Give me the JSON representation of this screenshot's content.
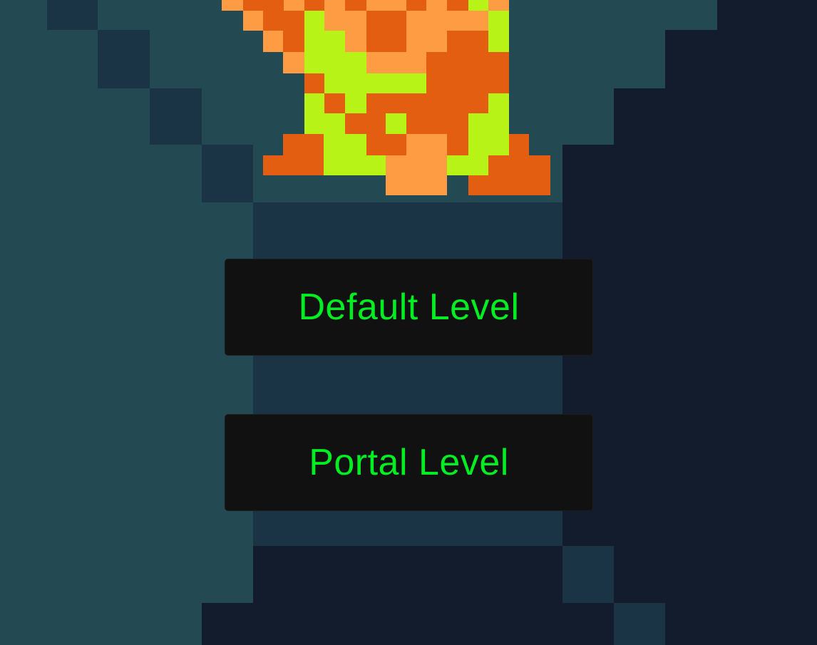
{
  "menu": {
    "buttons": [
      {
        "label": "Default Level"
      },
      {
        "label": "Portal Level"
      }
    ]
  },
  "colors": {
    "button_text": "#00ee22",
    "button_bg": "#111111",
    "wall_teal": "#234a52",
    "shadow_navy": "#1a3446",
    "void_dark": "#121c2c",
    "sprite_orange_dark": "#e35e10",
    "sprite_orange_light": "#fe9c44",
    "sprite_green": "#b8f318"
  },
  "sprite": {
    "name": "pixel-character-sprite"
  }
}
